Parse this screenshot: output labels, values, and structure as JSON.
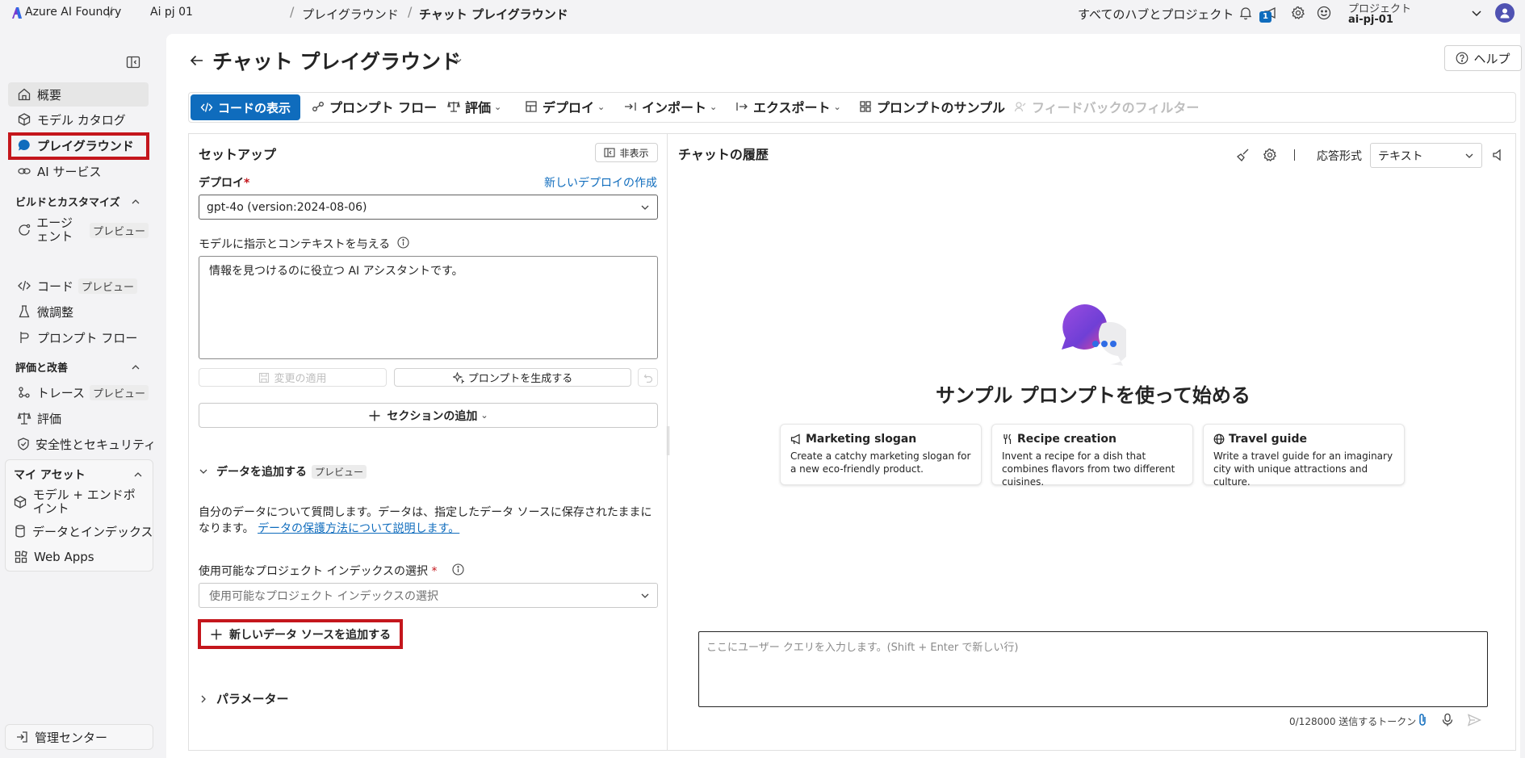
{
  "topbar": {
    "brand": "Azure AI Foundry",
    "project_crumb": "Ai pj 01",
    "crumb_playground": "プレイグラウンド",
    "crumb_chat": "チャット プレイグラウンド",
    "all_hubs": "すべてのハブとプロジェクト",
    "notification_count": "1",
    "project_label": "プロジェクト",
    "project_name": "ai-pj-01"
  },
  "sidebar": {
    "items": [
      {
        "label": "概要",
        "icon": "home-icon"
      },
      {
        "label": "モデル カタログ",
        "icon": "cube-icon"
      },
      {
        "label": "プレイグラウンド",
        "icon": "chat-icon"
      },
      {
        "label": "AI サービス",
        "icon": "link-icon"
      }
    ],
    "group_build": "ビルドとカスタマイズ",
    "build_items": [
      {
        "label": "エージェント",
        "badge": "プレビュー"
      },
      {
        "label": "コード",
        "badge": "プレビュー"
      },
      {
        "label": "微調整"
      },
      {
        "label": "プロンプト フロー"
      }
    ],
    "group_eval": "評価と改善",
    "eval_items": [
      {
        "label": "トレース",
        "badge": "プレビュー"
      },
      {
        "label": "評価"
      },
      {
        "label": "安全性とセキュリティ"
      }
    ],
    "group_assets": "マイ アセット",
    "asset_items": [
      {
        "label": "モデル + エンドポイント"
      },
      {
        "label": "データとインデックス"
      },
      {
        "label": "Web Apps"
      }
    ],
    "management": "管理センター"
  },
  "header": {
    "title": "チャット プレイグラウンド",
    "help": "ヘルプ"
  },
  "toolbar": {
    "view_code": "コードの表示",
    "prompt_flow": "プロンプト フロー",
    "evaluate": "評価",
    "deploy": "デプロイ",
    "import": "インポート",
    "export": "エクスポート",
    "prompt_samples": "プロンプトのサンプル",
    "feedback_filter": "フィードバックのフィルター"
  },
  "setup": {
    "title": "セットアップ",
    "hide": "非表示",
    "deploy_label": "デプロイ",
    "required": "*",
    "new_deploy": "新しいデプロイの作成",
    "deploy_value": "gpt-4o (version:2024-08-06)",
    "instructions_label": "モデルに指示とコンテキストを与える",
    "instructions_value": "情報を見つけるのに役立つ AI アシスタントです。",
    "apply_changes": "変更の適用",
    "generate_prompt": "プロンプトを生成する",
    "add_section": "セクションの追加",
    "add_data": "データを追加する",
    "preview": "プレビュー",
    "data_desc": "自分のデータについて質問します。データは、指定したデータ ソースに保存されたままになります。",
    "data_link": "データの保護方法について説明します。",
    "index_label": "使用可能なプロジェクト インデックスの選択",
    "index_placeholder": "使用可能なプロジェクト インデックスの選択",
    "add_datasource": "新しいデータ ソースを追加する",
    "parameters": "パラメーター"
  },
  "chat": {
    "title": "チャットの履歴",
    "response_format_label": "応答形式",
    "response_format_value": "テキスト",
    "start_title": "サンプル プロンプトを使って始める",
    "cards": [
      {
        "title": "Marketing slogan",
        "desc": "Create a catchy marketing slogan for a new eco-friendly product.",
        "icon": "megaphone-icon"
      },
      {
        "title": "Recipe creation",
        "desc": "Invent a recipe for a dish that combines flavors from two different cuisines.",
        "icon": "fork-knife-icon"
      },
      {
        "title": "Travel guide",
        "desc": "Write a travel guide for an imaginary city with unique attractions and culture.",
        "icon": "globe-icon"
      }
    ],
    "input_placeholder": "ここにユーザー クエリを入力します。(Shift + Enter で新しい行)",
    "token_count": "0/128000 送信するトークン"
  },
  "colors": {
    "accent": "#0f6cbd",
    "highlight_red": "#c4161c"
  }
}
